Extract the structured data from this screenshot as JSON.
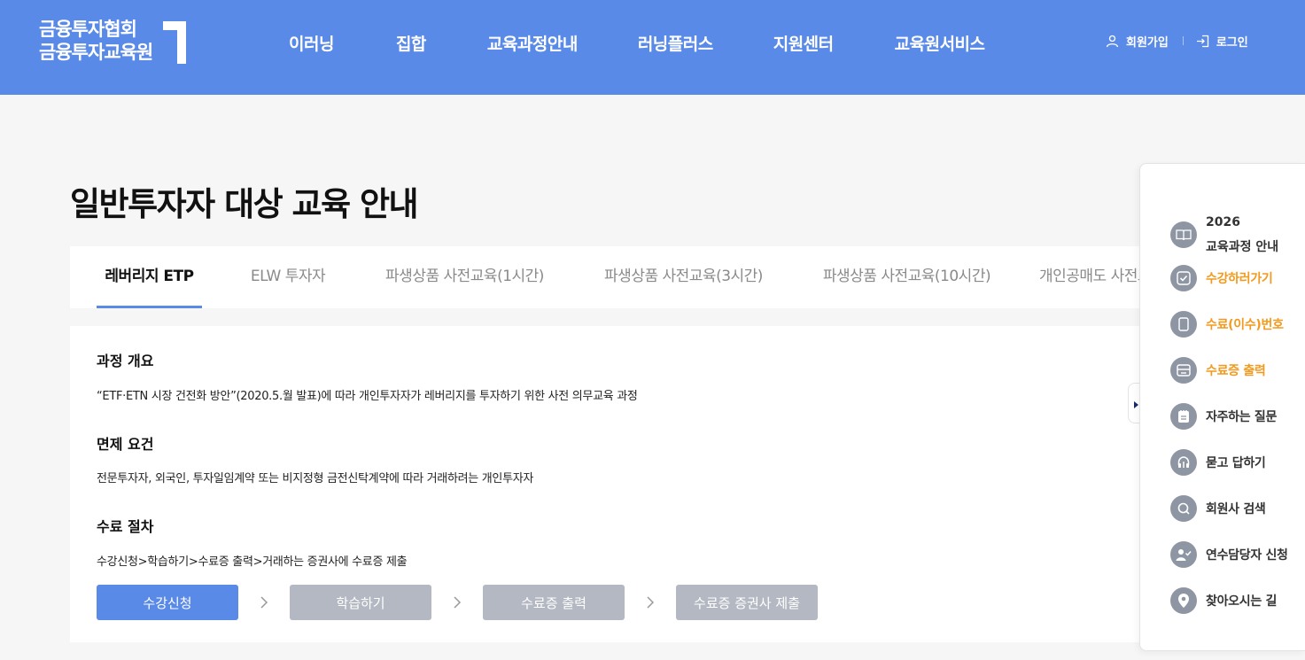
{
  "header": {
    "logo_line1": "금융투자협회",
    "logo_line2": "금융투자교육원",
    "nav": [
      "이러닝",
      "집합",
      "교육과정안내",
      "러닝플러스",
      "지원센터",
      "교육원서비스"
    ],
    "signup": "회원가입",
    "login": "로그인",
    "bg_color": "#5a8ae8"
  },
  "page": {
    "title": "일반투자자 대상 교육 안내"
  },
  "tabs": [
    "레버리지 ETP",
    "ELW 투자자",
    "파생상품 사전교육(1시간)",
    "파생상품 사전교육(3시간)",
    "파생상품 사전교육(10시간)",
    "개인공매도 사전교육"
  ],
  "active_tab": 0,
  "sections": {
    "overview_title": "과정 개요",
    "overview_text": "“ETF·ETN 시장 건전화 방안”(2020.5.월 발표)에 따라 개인투자자가 레버리지를 투자하기 위한 사전 의무교육 과정",
    "exempt_title": "면제 요건",
    "exempt_text": "전문투자자, 외국인, 투자일임계약 또는 비지정형 금전신탁계약에 따라 거래하려는 개인투자자",
    "process_title": "수료 절차",
    "process_text": "수강신청>학습하기>수료증 출력>거래하는 증권사에 수료증 제출"
  },
  "steps": [
    "수강신청",
    "학습하기",
    "수료증 출력",
    "수료증 증권사 제출"
  ],
  "quick_menu": {
    "course_year": "2026",
    "course_label": "교육과정 안내",
    "items": [
      "수강하러가기",
      "수료(이수)번호",
      "수료증 출력",
      "자주하는 질문",
      "묻고 답하기",
      "회원사 검색",
      "연수담당자 신청",
      "찾아오시는 길"
    ],
    "highlight_color": "#f29a1e"
  }
}
